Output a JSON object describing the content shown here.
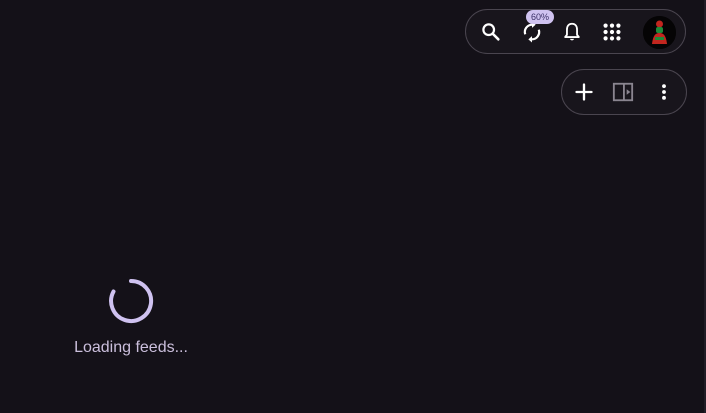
{
  "toolbar": {
    "icons": {
      "search": "search-icon",
      "sync": "sync-icon",
      "notifications": "bell-icon",
      "apps": "apps-grid-icon",
      "avatar": "user-avatar"
    },
    "sync_badge": "60%"
  },
  "actions": {
    "icons": {
      "add": "plus-icon",
      "panel": "side-panel-icon",
      "more": "more-vert-icon"
    }
  },
  "main": {
    "loading_text": "Loading feeds..."
  },
  "colors": {
    "background": "#141118",
    "pill_border": "#4a454f",
    "accent": "#cfc2f0",
    "text": "#cbbfdc",
    "avatar_red": "#c2261f",
    "avatar_green": "#1f8a3a"
  }
}
